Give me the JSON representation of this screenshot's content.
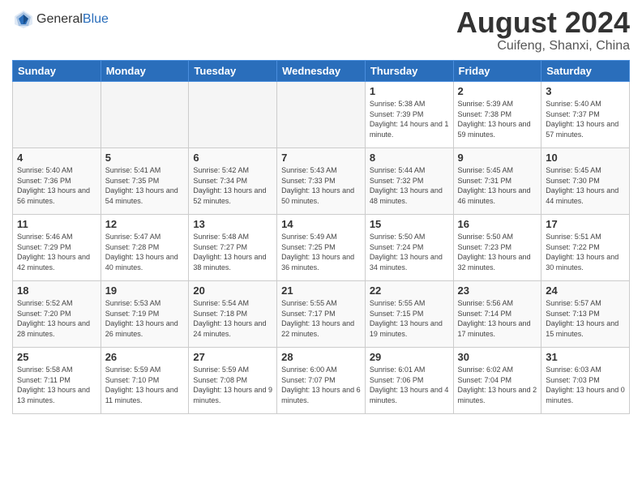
{
  "header": {
    "logo_general": "General",
    "logo_blue": "Blue",
    "month_year": "August 2024",
    "location": "Cuifeng, Shanxi, China"
  },
  "weekdays": [
    "Sunday",
    "Monday",
    "Tuesday",
    "Wednesday",
    "Thursday",
    "Friday",
    "Saturday"
  ],
  "weeks": [
    [
      {
        "day": "",
        "info": ""
      },
      {
        "day": "",
        "info": ""
      },
      {
        "day": "",
        "info": ""
      },
      {
        "day": "",
        "info": ""
      },
      {
        "day": "1",
        "info": "Sunrise: 5:38 AM\nSunset: 7:39 PM\nDaylight: 14 hours\nand 1 minute."
      },
      {
        "day": "2",
        "info": "Sunrise: 5:39 AM\nSunset: 7:38 PM\nDaylight: 13 hours\nand 59 minutes."
      },
      {
        "day": "3",
        "info": "Sunrise: 5:40 AM\nSunset: 7:37 PM\nDaylight: 13 hours\nand 57 minutes."
      }
    ],
    [
      {
        "day": "4",
        "info": "Sunrise: 5:40 AM\nSunset: 7:36 PM\nDaylight: 13 hours\nand 56 minutes."
      },
      {
        "day": "5",
        "info": "Sunrise: 5:41 AM\nSunset: 7:35 PM\nDaylight: 13 hours\nand 54 minutes."
      },
      {
        "day": "6",
        "info": "Sunrise: 5:42 AM\nSunset: 7:34 PM\nDaylight: 13 hours\nand 52 minutes."
      },
      {
        "day": "7",
        "info": "Sunrise: 5:43 AM\nSunset: 7:33 PM\nDaylight: 13 hours\nand 50 minutes."
      },
      {
        "day": "8",
        "info": "Sunrise: 5:44 AM\nSunset: 7:32 PM\nDaylight: 13 hours\nand 48 minutes."
      },
      {
        "day": "9",
        "info": "Sunrise: 5:45 AM\nSunset: 7:31 PM\nDaylight: 13 hours\nand 46 minutes."
      },
      {
        "day": "10",
        "info": "Sunrise: 5:45 AM\nSunset: 7:30 PM\nDaylight: 13 hours\nand 44 minutes."
      }
    ],
    [
      {
        "day": "11",
        "info": "Sunrise: 5:46 AM\nSunset: 7:29 PM\nDaylight: 13 hours\nand 42 minutes."
      },
      {
        "day": "12",
        "info": "Sunrise: 5:47 AM\nSunset: 7:28 PM\nDaylight: 13 hours\nand 40 minutes."
      },
      {
        "day": "13",
        "info": "Sunrise: 5:48 AM\nSunset: 7:27 PM\nDaylight: 13 hours\nand 38 minutes."
      },
      {
        "day": "14",
        "info": "Sunrise: 5:49 AM\nSunset: 7:25 PM\nDaylight: 13 hours\nand 36 minutes."
      },
      {
        "day": "15",
        "info": "Sunrise: 5:50 AM\nSunset: 7:24 PM\nDaylight: 13 hours\nand 34 minutes."
      },
      {
        "day": "16",
        "info": "Sunrise: 5:50 AM\nSunset: 7:23 PM\nDaylight: 13 hours\nand 32 minutes."
      },
      {
        "day": "17",
        "info": "Sunrise: 5:51 AM\nSunset: 7:22 PM\nDaylight: 13 hours\nand 30 minutes."
      }
    ],
    [
      {
        "day": "18",
        "info": "Sunrise: 5:52 AM\nSunset: 7:20 PM\nDaylight: 13 hours\nand 28 minutes."
      },
      {
        "day": "19",
        "info": "Sunrise: 5:53 AM\nSunset: 7:19 PM\nDaylight: 13 hours\nand 26 minutes."
      },
      {
        "day": "20",
        "info": "Sunrise: 5:54 AM\nSunset: 7:18 PM\nDaylight: 13 hours\nand 24 minutes."
      },
      {
        "day": "21",
        "info": "Sunrise: 5:55 AM\nSunset: 7:17 PM\nDaylight: 13 hours\nand 22 minutes."
      },
      {
        "day": "22",
        "info": "Sunrise: 5:55 AM\nSunset: 7:15 PM\nDaylight: 13 hours\nand 19 minutes."
      },
      {
        "day": "23",
        "info": "Sunrise: 5:56 AM\nSunset: 7:14 PM\nDaylight: 13 hours\nand 17 minutes."
      },
      {
        "day": "24",
        "info": "Sunrise: 5:57 AM\nSunset: 7:13 PM\nDaylight: 13 hours\nand 15 minutes."
      }
    ],
    [
      {
        "day": "25",
        "info": "Sunrise: 5:58 AM\nSunset: 7:11 PM\nDaylight: 13 hours\nand 13 minutes."
      },
      {
        "day": "26",
        "info": "Sunrise: 5:59 AM\nSunset: 7:10 PM\nDaylight: 13 hours\nand 11 minutes."
      },
      {
        "day": "27",
        "info": "Sunrise: 5:59 AM\nSunset: 7:08 PM\nDaylight: 13 hours\nand 9 minutes."
      },
      {
        "day": "28",
        "info": "Sunrise: 6:00 AM\nSunset: 7:07 PM\nDaylight: 13 hours\nand 6 minutes."
      },
      {
        "day": "29",
        "info": "Sunrise: 6:01 AM\nSunset: 7:06 PM\nDaylight: 13 hours\nand 4 minutes."
      },
      {
        "day": "30",
        "info": "Sunrise: 6:02 AM\nSunset: 7:04 PM\nDaylight: 13 hours\nand 2 minutes."
      },
      {
        "day": "31",
        "info": "Sunrise: 6:03 AM\nSunset: 7:03 PM\nDaylight: 13 hours\nand 0 minutes."
      }
    ]
  ]
}
